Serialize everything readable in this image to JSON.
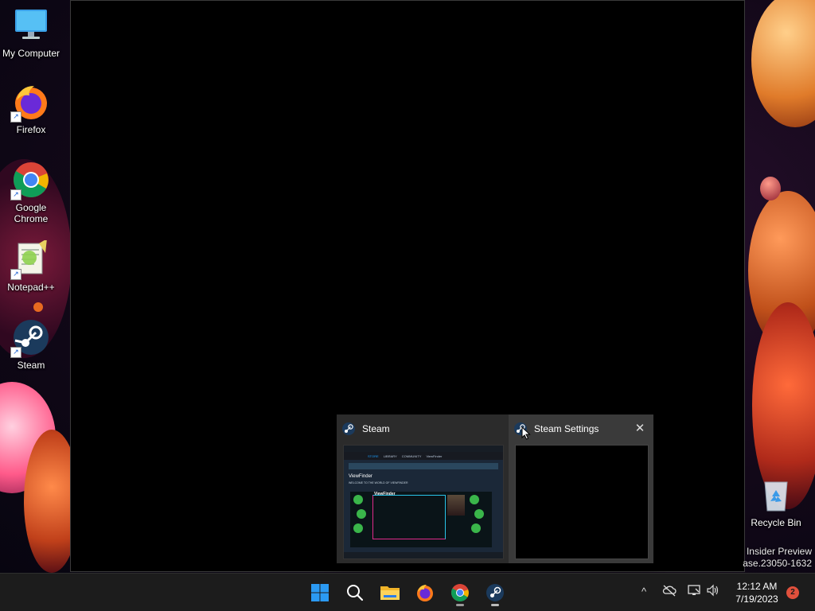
{
  "desktop": {
    "icons": [
      {
        "label": "My Computer",
        "icon": "computer-monitor-icon"
      },
      {
        "label": "Firefox",
        "icon": "firefox-icon"
      },
      {
        "label": "Google Chrome",
        "icon": "chrome-icon"
      },
      {
        "label": "Notepad++",
        "icon": "notepad-plus-plus-icon"
      },
      {
        "label": "Steam",
        "icon": "steam-icon"
      },
      {
        "label": "Recycle Bin",
        "icon": "recycle-bin-icon"
      }
    ],
    "watermark": {
      "line1": "Insider Preview",
      "line2": "ase.23050-1632"
    }
  },
  "flyout": {
    "thumbnails": [
      {
        "title": "Steam",
        "preview": {
          "nav_items": [
            "STORE",
            "LIBRARY",
            "COMMUNITY",
            "ViewFinder"
          ],
          "section_title": "ViewFinder",
          "banner_caption": "WELCOME TO THE WORLD OF VIEWFINDER",
          "game_title": "ViewFinder"
        }
      },
      {
        "title": "Steam Settings",
        "close_label": "✕"
      }
    ]
  },
  "taskbar": {
    "pinned": [
      "start-button",
      "search",
      "file-explorer",
      "firefox",
      "chrome",
      "steam"
    ],
    "clock": {
      "time": "12:12 AM",
      "date": "7/19/2023"
    },
    "notifications_count": "2",
    "tray": {
      "chevron": "^"
    }
  },
  "colors": {
    "taskbar_bg": "#1c1c1c",
    "flyout_bg": "#2b2b2b",
    "accent": "#0078d4",
    "notif_badge": "#e0503c"
  }
}
